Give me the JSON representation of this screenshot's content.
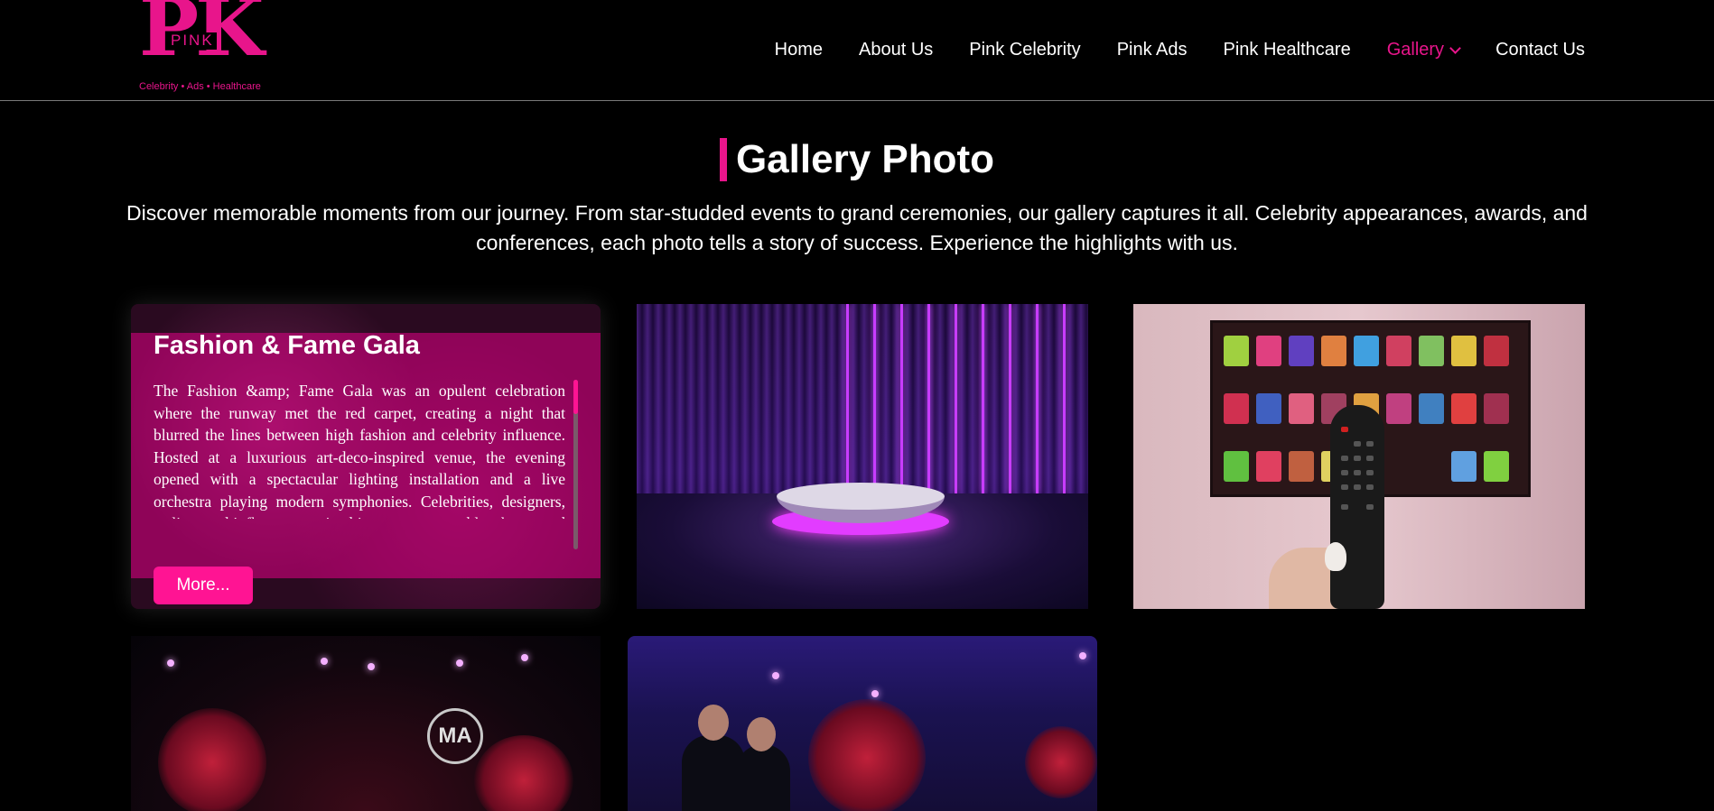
{
  "brand": {
    "logo_letters": "PK",
    "logo_word": "PINK",
    "tagline": "Celebrity • Ads • Healthcare"
  },
  "nav": {
    "items": [
      {
        "label": "Home"
      },
      {
        "label": "About Us"
      },
      {
        "label": "Pink Celebrity"
      },
      {
        "label": "Pink Ads"
      },
      {
        "label": "Pink Healthcare"
      },
      {
        "label": "Gallery",
        "active": true
      },
      {
        "label": "Contact Us"
      }
    ]
  },
  "page": {
    "title": "Gallery Photo",
    "subtitle": "Discover memorable moments from our journey. From star-studded events to grand ceremonies, our gallery captures it all. Celebrity appearances, awards, and conferences, each photo tells a story of success. Experience the highlights with us."
  },
  "gallery": {
    "featured": {
      "title": "Fashion & Fame Gala",
      "description": "The Fashion &amp; Fame Gala was an opulent celebration where the runway met the red carpet, creating a night that blurred the lines between high fashion and celebrity influence. Hosted at a luxurious art-deco-inspired venue, the evening opened with a spectacular lighting installation and a live orchestra playing modern symphonies. Celebrities, designers, stylists, and influencers arrived in couture ensembles that turned the venue into a living",
      "more_label": "More..."
    },
    "event_logo_text": "MA"
  },
  "colors": {
    "accent": "#e8158b",
    "button": "#ff1493",
    "background": "#000000"
  },
  "icons": {
    "gallery_dropdown": "chevron-down-icon"
  }
}
